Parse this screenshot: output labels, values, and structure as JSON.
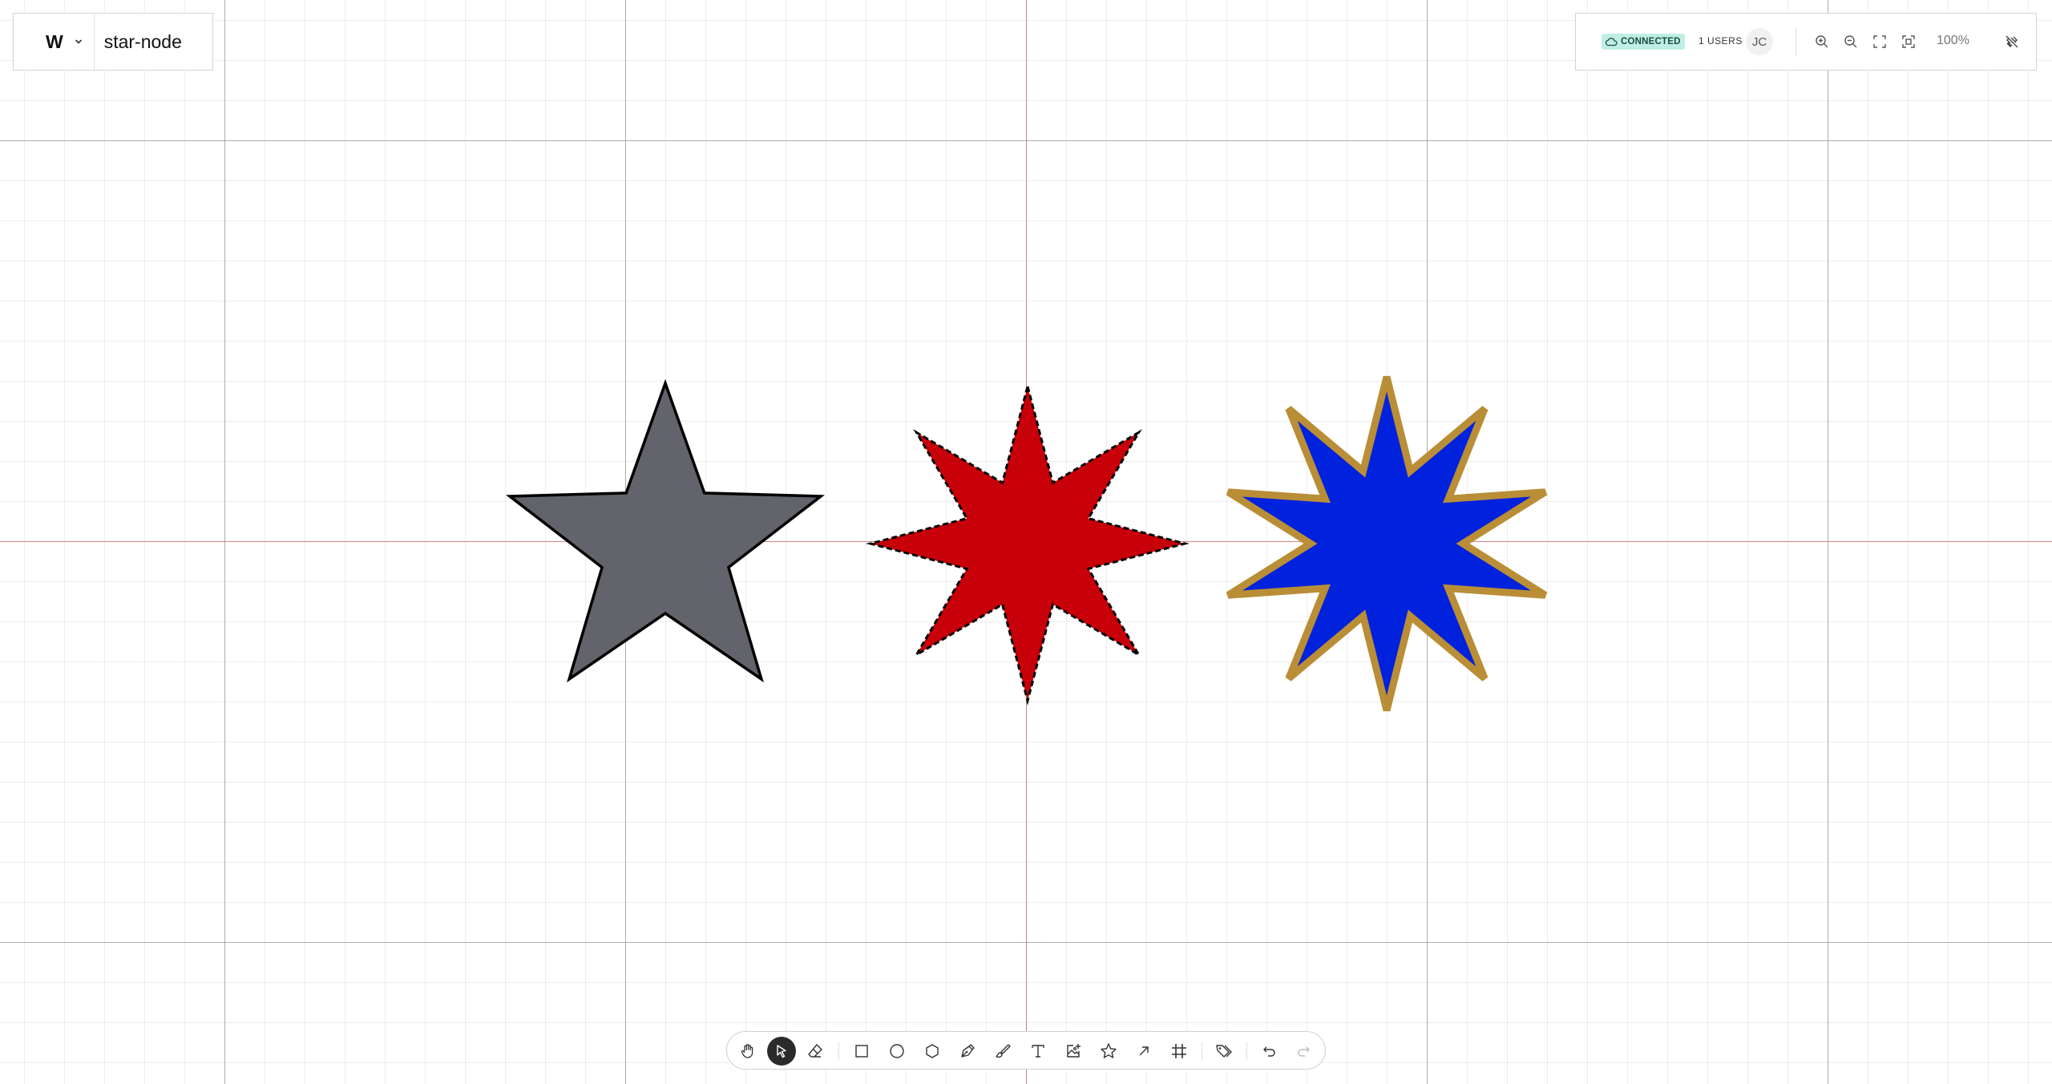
{
  "document": {
    "logo": "W",
    "title": "star-node"
  },
  "status": {
    "connection": "CONNECTED",
    "users": "1 USERS",
    "avatar_initials": "JC",
    "zoom": "100%"
  },
  "header_icons": [
    "zoom-in-icon",
    "zoom-out-icon",
    "fit-screen-icon",
    "fit-selection-icon",
    "debug-icon"
  ],
  "toolbar": {
    "active_tool": "select",
    "tools": [
      "hand",
      "select",
      "eraser",
      "rectangle",
      "ellipse",
      "polygon",
      "pen",
      "brush",
      "text",
      "image",
      "star",
      "arrow",
      "frame",
      "tag",
      "undo",
      "redo"
    ]
  },
  "shapes": [
    {
      "type": "star",
      "points": 5,
      "fill": "#63636b",
      "stroke": "#000000",
      "stroke_style": "solid"
    },
    {
      "type": "star",
      "points": 8,
      "fill": "#c8000a",
      "stroke": "#000000",
      "stroke_style": "dashed"
    },
    {
      "type": "star",
      "points": 10,
      "fill": "#0022dd",
      "stroke": "#b98e36",
      "stroke_style": "solid"
    }
  ],
  "colors": {
    "accent_connected_bg": "#bfeee4",
    "toolbar_active": "#2b2b2b",
    "axis": "#ff5050"
  }
}
